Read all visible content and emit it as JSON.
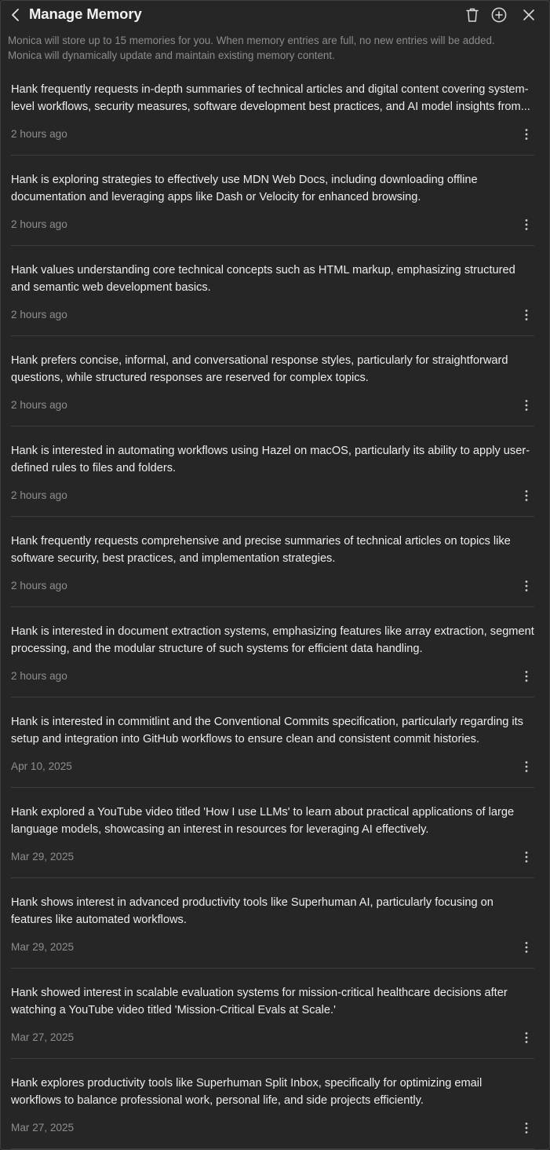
{
  "header": {
    "title": "Manage Memory",
    "icons": {
      "back": "chevron-left-icon",
      "trash": "trash-icon",
      "add": "plus-circle-icon",
      "close": "close-icon"
    }
  },
  "notice": {
    "line1": "Monica will store up to 15 memories for you. When memory entries are full, no new entries will be added.",
    "line2": "Monica will dynamically update and maintain existing memory content."
  },
  "memories": [
    {
      "text": "Hank frequently requests in-depth summaries of technical articles and digital content covering system-level workflows, security measures, software development best practices, and AI model insights from...",
      "time": "2 hours ago"
    },
    {
      "text": "Hank is exploring strategies to effectively use MDN Web Docs, including downloading offline documentation and leveraging apps like Dash or Velocity for enhanced browsing.",
      "time": "2 hours ago"
    },
    {
      "text": "Hank values understanding core technical concepts such as HTML markup, emphasizing structured and semantic web development basics.",
      "time": "2 hours ago"
    },
    {
      "text": "Hank prefers concise, informal, and conversational response styles, particularly for straightforward questions, while structured responses are reserved for complex topics.",
      "time": "2 hours ago"
    },
    {
      "text": "Hank is interested in automating workflows using Hazel on macOS, particularly its ability to apply user-defined rules to files and folders.",
      "time": "2 hours ago"
    },
    {
      "text": "Hank frequently requests comprehensive and precise summaries of technical articles on topics like software security, best practices, and implementation strategies.",
      "time": "2 hours ago"
    },
    {
      "text": "Hank is interested in document extraction systems, emphasizing features like array extraction, segment processing, and the modular structure of such systems for efficient data handling.",
      "time": "2 hours ago"
    },
    {
      "text": "Hank is interested in commitlint and the Conventional Commits specification, particularly regarding its setup and integration into GitHub workflows to ensure clean and consistent commit histories.",
      "time": "Apr 10, 2025"
    },
    {
      "text": "Hank explored a YouTube video titled 'How I use LLMs' to learn about practical applications of large language models, showcasing an interest in resources for leveraging AI effectively.",
      "time": "Mar 29, 2025"
    },
    {
      "text": "Hank shows interest in advanced productivity tools like Superhuman AI, particularly focusing on features like automated workflows.",
      "time": "Mar 29, 2025"
    },
    {
      "text": "Hank showed interest in scalable evaluation systems for mission-critical healthcare decisions after watching a YouTube video titled 'Mission-Critical Evals at Scale.'",
      "time": "Mar 27, 2025"
    },
    {
      "text": "Hank explores productivity tools like Superhuman Split Inbox, specifically for optimizing email workflows to balance professional work, personal life, and side projects efficiently.",
      "time": "Mar 27, 2025"
    }
  ],
  "item_icon": "more-vertical-icon",
  "colors": {
    "background": "#262626",
    "text": "#ededed",
    "muted": "#8c8c8c",
    "divider": "#3d3d3d"
  }
}
